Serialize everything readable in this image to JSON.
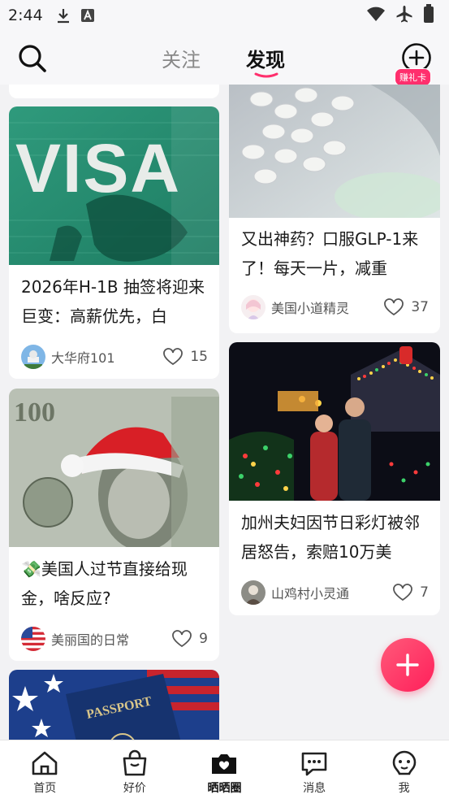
{
  "status_bar": {
    "time": "2:44",
    "icons": [
      "download-icon",
      "a-badge-icon",
      "wifi-icon",
      "airplane-mode-icon",
      "battery-icon"
    ]
  },
  "header": {
    "tabs": [
      {
        "label": "关注",
        "active": false
      },
      {
        "label": "发现",
        "active": true
      }
    ],
    "gift_badge": "赚礼卡",
    "accent_color": "#ff2f6d"
  },
  "feed": {
    "left": [
      {
        "image": "visa-document-photo",
        "title": "2026年H-1B 抽签将迎来巨变：高薪优先，白",
        "author": "大华府101",
        "likes": "15"
      },
      {
        "image": "dollar-bill-santa-hat-photo",
        "title_emoji": "💸",
        "title": "美国人过节直接给现金，啥反应?",
        "author": "美丽国的日常",
        "likes": "9"
      },
      {
        "image": "us-passport-flag-photo"
      }
    ],
    "right": [
      {
        "image": "white-pills-photo",
        "title": "又出神药？口服GLP-1来了！每天一片，减重",
        "author": "美国小道精灵",
        "likes": "37"
      },
      {
        "image": "christmas-lights-couple-photo",
        "title": "加州夫妇因节日彩灯被邻居怒告，索赔10万美",
        "author": "山鸡村小灵通",
        "likes": "7"
      }
    ]
  },
  "bottom_nav": [
    {
      "label": "首页",
      "icon": "home-icon",
      "active": false
    },
    {
      "label": "好价",
      "icon": "shopping-bag-icon",
      "active": false
    },
    {
      "label": "晒晒圈",
      "icon": "camera-heart-icon",
      "active": true
    },
    {
      "label": "消息",
      "icon": "chat-bubble-icon",
      "active": false
    },
    {
      "label": "我",
      "icon": "face-icon",
      "active": false
    }
  ]
}
